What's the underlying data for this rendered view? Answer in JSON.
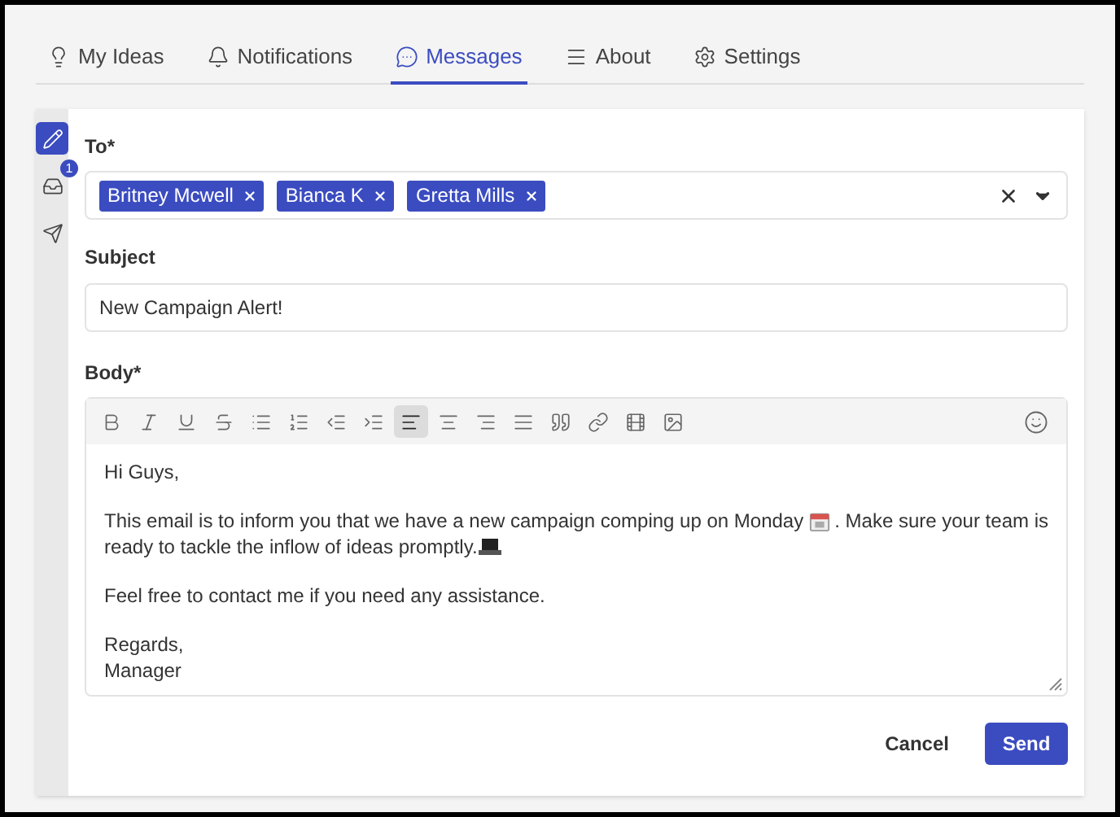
{
  "tabs": [
    {
      "label": "My Ideas",
      "selected": false
    },
    {
      "label": "Notifications",
      "selected": false
    },
    {
      "label": "Messages",
      "selected": true
    },
    {
      "label": "About",
      "selected": false
    },
    {
      "label": "Settings",
      "selected": false
    }
  ],
  "side_nav": [
    {
      "selected": true
    },
    {
      "selected": false,
      "badge": "1"
    },
    {
      "selected": false
    }
  ],
  "form": {
    "to": {
      "label": "To*",
      "recipients": [
        "Britney Mcwell",
        "Bianca K",
        "Gretta Mills"
      ]
    },
    "subject": {
      "label": "Subject",
      "value": "New Campaign Alert!"
    },
    "body": {
      "label": "Body*",
      "toolbar": [
        {
          "kind": "bold",
          "selected": false
        },
        {
          "kind": "italic",
          "selected": false
        },
        {
          "kind": "underline",
          "selected": false
        },
        {
          "kind": "strike",
          "selected": false
        },
        {
          "kind": "bullets",
          "selected": false
        },
        {
          "kind": "numbers",
          "selected": false
        },
        {
          "kind": "outdent",
          "selected": false
        },
        {
          "kind": "indent",
          "selected": false
        },
        {
          "kind": "align-left",
          "selected": true
        },
        {
          "kind": "align-center",
          "selected": false
        },
        {
          "kind": "align-right",
          "selected": false
        },
        {
          "kind": "justify",
          "selected": false
        },
        {
          "kind": "quote",
          "selected": false
        },
        {
          "kind": "link",
          "selected": false
        },
        {
          "kind": "video",
          "selected": false
        },
        {
          "kind": "image",
          "selected": false
        }
      ],
      "paragraphs": [
        [
          [
            {
              "kind": "text",
              "text": "Hi Guys,"
            }
          ]
        ],
        [
          [
            {
              "kind": "text",
              "text": "This email is to inform you that we have a new campaign comping up on Monday"
            },
            {
              "kind": "calendar"
            },
            {
              "kind": "text",
              "text": ". Make sure your team is"
            }
          ],
          [
            {
              "kind": "text",
              "text": "ready to tackle the inflow of ideas promptly."
            },
            {
              "kind": "laptop"
            }
          ]
        ],
        [
          [
            {
              "kind": "text",
              "text": "Feel free to contact me if you need any assistance."
            }
          ]
        ],
        [
          [
            {
              "kind": "text",
              "text": "Regards,"
            }
          ],
          [
            {
              "kind": "text",
              "text": "Manager"
            }
          ]
        ]
      ]
    }
  },
  "buttons": {
    "cancel": "Cancel",
    "send": "Send"
  }
}
